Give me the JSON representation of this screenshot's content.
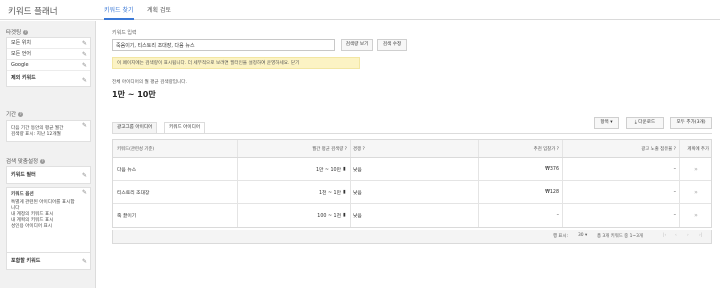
{
  "app": {
    "title": "키워드 플래너"
  },
  "tabs": [
    {
      "label": "키워드 찾기"
    },
    {
      "label": "계획 검토"
    }
  ],
  "sidebar": {
    "targeting": {
      "title": "타겟팅",
      "items": [
        "모든 위치",
        "모든 언어",
        "Google",
        "제외 키워드"
      ]
    },
    "period": {
      "title": "기간",
      "lines": [
        "다음 기간 동안의 평균 월간",
        "검색량 표시: 지난 12개월"
      ]
    },
    "search_options": {
      "title": "검색 맞춤설정",
      "keyword_filter": "키워드 필터",
      "keyword_options": "키워드 옵션",
      "option_lines": [
        "특별게 관련된 아이디어를 표시합",
        "니다",
        "내 계정의 키워드 표시",
        "내 계획의 키워드 표시",
        "성인용 아이디어 표시"
      ],
      "include_keywords": "포함할 키워드"
    }
  },
  "main": {
    "keyword_input_label": "키워드 입력",
    "keyword_input_value": "죽음이기, 티스토리 조대장, 다음 뉴스",
    "get_volume_button": "검색량 보기",
    "edit_search_button": "검색 수정",
    "notice": "이 페이지에는 검색량이 표시됩니다. 더 세부적으로 보려면 필터인을 설정하여 운영하세요. 닫기",
    "avg_label": "전체 아이디어의 월 평균 검색량입니다.",
    "avg_value": "1만 ~ 10만",
    "columns_button": "항목 ▾",
    "download_button": "다운로드",
    "add_all_button": "모두 추가(3개)",
    "subtabs": [
      "광고그룹 아이디어",
      "키워드 아이디어"
    ]
  },
  "table": {
    "headers": [
      "키워드(관련성 기준)",
      "월간 평균 검색량 ?",
      "경쟁 ?",
      "추천 입찰가 ?",
      "광고 노출 점유율 ?",
      "계획에 추가"
    ],
    "rows": [
      {
        "keyword": "다음 뉴스",
        "volume": "1만 ~ 10만",
        "competition": "낮음",
        "bid": "₩376",
        "share": "–"
      },
      {
        "keyword": "티스토리 조대장",
        "volume": "1천 ~ 1만",
        "competition": "낮음",
        "bid": "₩128",
        "share": "–"
      },
      {
        "keyword": "죽 끓이기",
        "volume": "100 ~ 1천",
        "competition": "낮음",
        "bid": "–",
        "share": "–"
      }
    ]
  },
  "pagination": {
    "rows_label": "행 표시:",
    "rows_value": "30 ▾",
    "range": "총 3개 키워드 중 1~3개"
  }
}
